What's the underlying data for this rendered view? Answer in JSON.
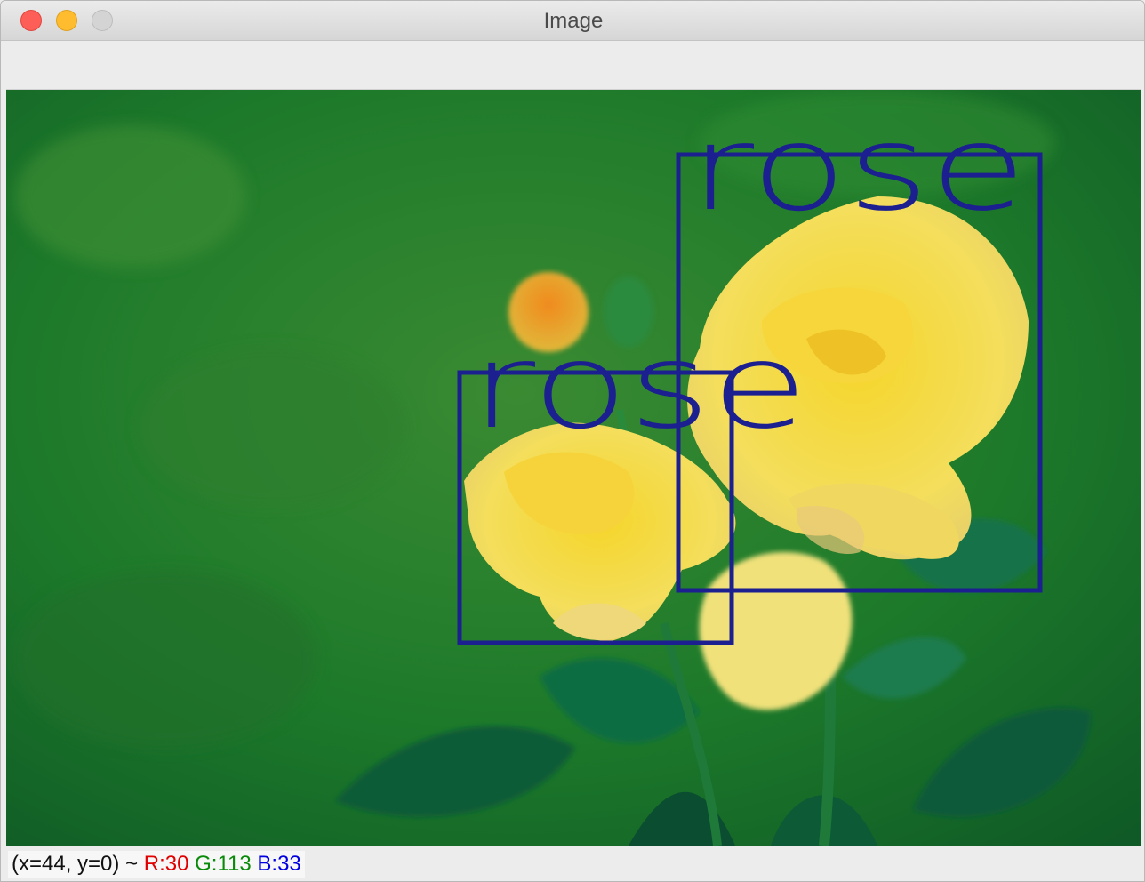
{
  "window": {
    "title": "Image"
  },
  "image": {
    "detections": [
      {
        "label": "rose"
      },
      {
        "label": "rose"
      }
    ],
    "box_color": "#1b1f8f"
  },
  "status": {
    "coords": "(x=44, y=0) ~",
    "r": "R:30",
    "g": "G:113",
    "b": "B:33",
    "colors": {
      "r": "#e00000",
      "g": "#0a8a0a",
      "b": "#0000e0"
    }
  }
}
